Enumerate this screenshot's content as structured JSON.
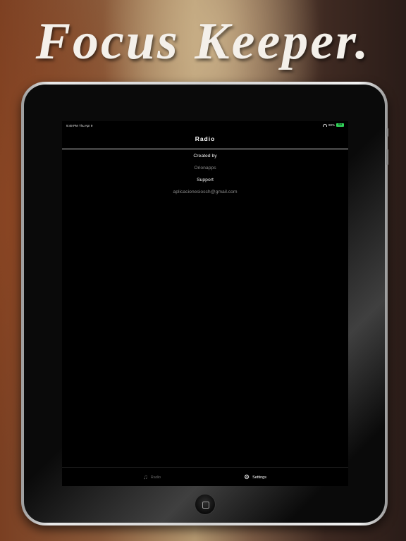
{
  "headline": "Focus Keeper.",
  "status_bar": {
    "time": "9:49 PM   Thu Apr 9",
    "battery": "90%",
    "battery_label": "RM"
  },
  "nav": {
    "title": "Radio"
  },
  "settings": {
    "created_by_label": "Created by",
    "created_by_value": "Orionapps",
    "support_label": "Support",
    "support_value": "aplicacionesiosch@gmail.com"
  },
  "tab_bar": {
    "radio_label": "Radio",
    "settings_label": "Settings"
  },
  "colors": {
    "screen_bg": "#000000",
    "battery_green": "#30d158",
    "inactive_tab": "#6a6a6a"
  },
  "icons": {
    "radio_tab": "music-note-icon",
    "settings_tab": "gear-icon",
    "wifi": "wifi-icon",
    "battery": "battery-icon",
    "home": "home-button-icon"
  }
}
